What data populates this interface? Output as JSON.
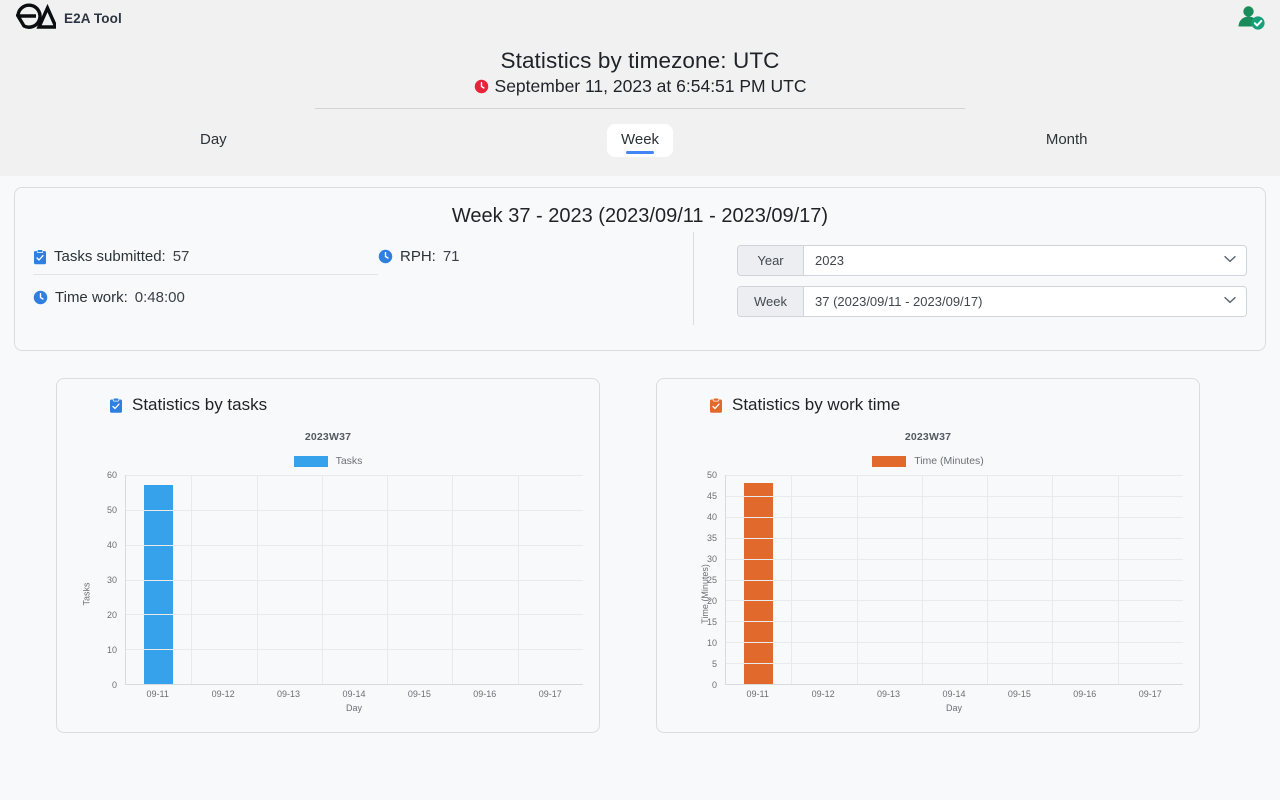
{
  "brand": {
    "name": "E2A Tool",
    "logo_icon": "e2a-logo-icon"
  },
  "account": {
    "icon": "user-verified-icon"
  },
  "header": {
    "title": "Statistics by timezone: UTC",
    "clock_icon": "red-clock-icon",
    "datetime": "September 11, 2023 at 6:54:51 PM UTC"
  },
  "tabs": [
    {
      "label": "Day",
      "active": false
    },
    {
      "label": "Week",
      "active": true
    },
    {
      "label": "Month",
      "active": false
    }
  ],
  "summary": {
    "title": "Week 37 - 2023 (2023/09/11 - 2023/09/17)",
    "stats": [
      {
        "icon": "clipboard-check-icon",
        "label": "Tasks submitted:",
        "value": "57"
      },
      {
        "icon": "clock-icon",
        "label": "RPH:",
        "value": "71"
      },
      {
        "icon": "clock-icon",
        "label": "Time work:",
        "value": "0:48:00"
      }
    ],
    "fields": [
      {
        "label": "Year",
        "value": "2023"
      },
      {
        "label": "Week",
        "value": "37 (2023/09/11 - 2023/09/17)"
      }
    ]
  },
  "colors": {
    "tasks": "#36a2eb",
    "time": "#e2692c",
    "accent": "#4285f4",
    "clock_red": "#e8243b",
    "icon_blue": "#2f7fe0",
    "icon_orange": "#e2692c",
    "avatar_green": "#1b8b5a"
  },
  "chart_data": [
    {
      "type": "bar",
      "card_title": "Statistics by tasks",
      "card_icon": "clipboard-blue-icon",
      "title": "2023W37",
      "xlabel": "Day",
      "ylabel": "Tasks",
      "legend": "Tasks",
      "legend_position": "top",
      "grid": true,
      "color": "#36a2eb",
      "categories": [
        "09-11",
        "09-12",
        "09-13",
        "09-14",
        "09-15",
        "09-16",
        "09-17"
      ],
      "values": [
        57,
        0,
        0,
        0,
        0,
        0,
        0
      ],
      "ylim": [
        0,
        60
      ],
      "yticks": [
        0,
        10,
        20,
        30,
        40,
        50,
        60
      ]
    },
    {
      "type": "bar",
      "card_title": "Statistics by work time",
      "card_icon": "clipboard-orange-icon",
      "title": "2023W37",
      "xlabel": "Day",
      "ylabel": "Time (Minutes)",
      "legend": "Time (Minutes)",
      "legend_position": "top",
      "grid": true,
      "color": "#e2692c",
      "categories": [
        "09-11",
        "09-12",
        "09-13",
        "09-14",
        "09-15",
        "09-16",
        "09-17"
      ],
      "values": [
        48,
        0,
        0,
        0,
        0,
        0,
        0
      ],
      "ylim": [
        0,
        50
      ],
      "yticks": [
        0,
        5,
        10,
        15,
        20,
        25,
        30,
        35,
        40,
        45,
        50
      ]
    }
  ]
}
